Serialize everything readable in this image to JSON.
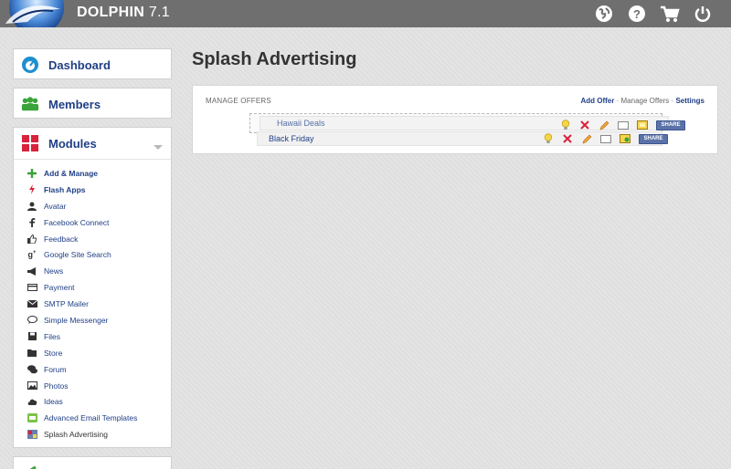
{
  "header": {
    "brand": "DOLPHIN",
    "version": "7.1",
    "icons": [
      "globe-icon",
      "help-icon",
      "cart-icon",
      "power-icon"
    ]
  },
  "sidebar": {
    "dashboard": {
      "label": "Dashboard",
      "icon": "gauge-icon"
    },
    "members": {
      "label": "Members",
      "icon": "users-icon"
    },
    "modules": {
      "label": "Modules",
      "icon": "grid-icon",
      "items": [
        {
          "label": "Add & Manage",
          "icon": "plus-icon",
          "bold": true
        },
        {
          "label": "Flash Apps",
          "icon": "flash-icon",
          "bold": true
        },
        {
          "label": "Avatar",
          "icon": "user-icon"
        },
        {
          "label": "Facebook Connect",
          "icon": "facebook-icon"
        },
        {
          "label": "Feedback",
          "icon": "thumbs-up-icon"
        },
        {
          "label": "Google Site Search",
          "icon": "google-plus-icon"
        },
        {
          "label": "News",
          "icon": "megaphone-icon"
        },
        {
          "label": "Payment",
          "icon": "credit-card-icon"
        },
        {
          "label": "SMTP Mailer",
          "icon": "envelope-icon"
        },
        {
          "label": "Simple Messenger",
          "icon": "chat-icon"
        },
        {
          "label": "Files",
          "icon": "save-icon"
        },
        {
          "label": "Store",
          "icon": "folder-icon"
        },
        {
          "label": "Forum",
          "icon": "comments-icon"
        },
        {
          "label": "Photos",
          "icon": "picture-icon"
        },
        {
          "label": "Ideas",
          "icon": "cloud-icon"
        },
        {
          "label": "Advanced Email Templates",
          "icon": "email-template-icon"
        },
        {
          "label": "Splash Advertising",
          "icon": "splash-icon",
          "dark": true
        }
      ]
    }
  },
  "main": {
    "title": "Splash Advertising",
    "panel": {
      "label": "MANAGE OFFERS",
      "add_offer": "Add Offer",
      "sep": "·",
      "manage_offers": "Manage Offers",
      "settings": "Settings"
    },
    "offers": [
      {
        "name": "Hawaii Deals",
        "share": "SHARE"
      },
      {
        "name": "Black Friday",
        "share": "SHARE"
      }
    ]
  },
  "colors": {
    "topbar": "#6f6f6f",
    "link": "#1f3f86",
    "accent_red": "#d9223b",
    "accent_green": "#3aa33a"
  }
}
